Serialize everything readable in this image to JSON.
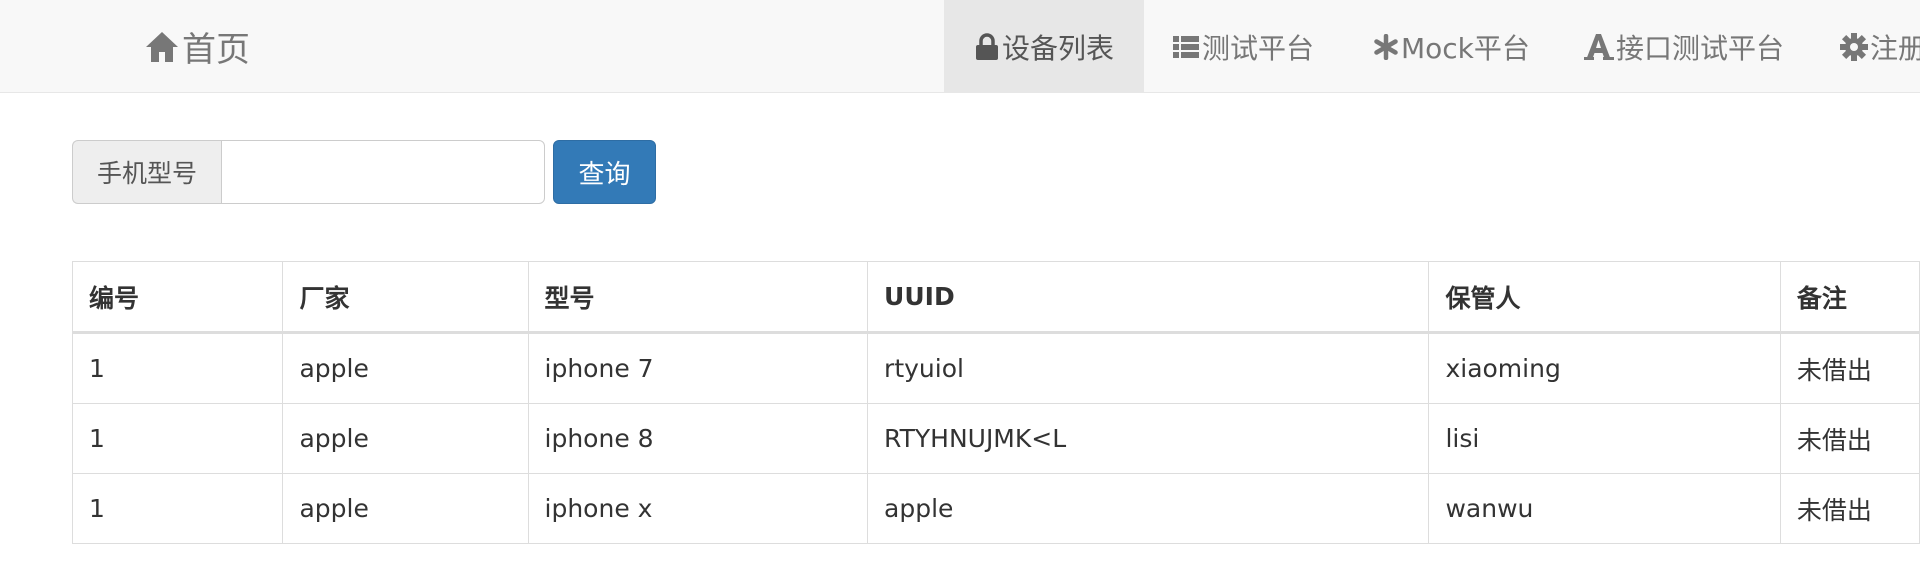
{
  "nav": {
    "brand": {
      "label": "首页",
      "icon": "home-icon"
    },
    "items": [
      {
        "label": "设备列表",
        "icon": "lock-icon",
        "active": true
      },
      {
        "label": "测试平台",
        "icon": "list-icon",
        "active": false
      },
      {
        "label": "Mock平台",
        "icon": "asterisk-icon",
        "active": false
      },
      {
        "label": "接口测试平台",
        "icon": "font-icon",
        "active": false
      },
      {
        "label": "注册",
        "icon": "gear-icon",
        "active": false
      }
    ]
  },
  "search": {
    "addon_label": "手机型号",
    "value": "",
    "placeholder": "",
    "button_label": "查询"
  },
  "table": {
    "headers": [
      "编号",
      "厂家",
      "型号",
      "UUID",
      "保管人",
      "备注"
    ],
    "rows": [
      [
        "1",
        "apple",
        "iphone 7",
        "rtyuiol",
        "xiaoming",
        "未借出"
      ],
      [
        "1",
        "apple",
        "iphone 8",
        "RTYHNUJMK<L",
        "lisi",
        "未借出"
      ],
      [
        "1",
        "apple",
        "iphone x",
        "apple",
        "wanwu",
        "未借出"
      ]
    ]
  },
  "colors": {
    "navbar_bg": "#f8f8f8",
    "active_nav_bg": "#e7e7e7",
    "primary_button": "#337ab7"
  }
}
